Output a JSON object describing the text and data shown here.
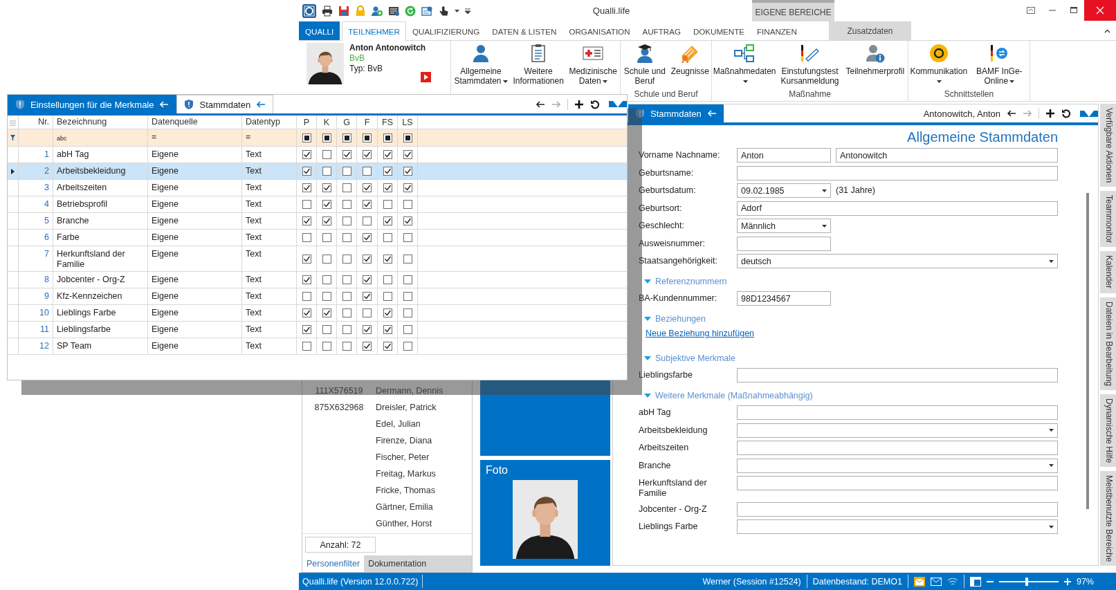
{
  "window": {
    "title": "Qualli.life",
    "context_group": "EIGENE BEREICHE"
  },
  "ribbon": {
    "tabs": [
      {
        "label": "QUALLI",
        "kind": "app",
        "selected": false
      },
      {
        "label": "TEILNEHMER",
        "kind": "tab",
        "selected": true
      },
      {
        "label": "QUALIFIZIERUNG",
        "kind": "tab",
        "selected": false
      },
      {
        "label": "DATEN & LISTEN",
        "kind": "tab",
        "selected": false
      },
      {
        "label": "ORGANISATION",
        "kind": "tab",
        "selected": false
      },
      {
        "label": "AUFTRAG",
        "kind": "tab",
        "selected": false
      },
      {
        "label": "DOKUMENTE",
        "kind": "tab",
        "selected": false
      },
      {
        "label": "FINANZEN",
        "kind": "tab",
        "selected": false
      },
      {
        "label": "Zusatzdaten",
        "kind": "context",
        "selected": false
      }
    ],
    "participant": {
      "name": "Anton Antonowitch",
      "program": "BvB",
      "type": "Typ: BvB"
    },
    "groups": [
      {
        "buttons": [
          {
            "label": "Allgemeine Stammdaten",
            "dropdown": true
          },
          {
            "label": "Weitere Informationen",
            "dropdown": false
          },
          {
            "label": "Medizinische Daten",
            "dropdown": true
          }
        ]
      },
      {
        "label": "Schule und Beruf",
        "buttons": [
          {
            "label": "Schule und Beruf",
            "dropdown": false
          },
          {
            "label": "Zeugnisse",
            "dropdown": false
          }
        ]
      },
      {
        "label": "Maßnahme",
        "buttons": [
          {
            "label": "Maßnahmedaten",
            "dropdown": true
          },
          {
            "label": "Einstufungstest Kursanmeldung",
            "dropdown": false
          },
          {
            "label": "Teilnehmerprofil",
            "dropdown": false
          }
        ]
      },
      {
        "label": "Schnittstellen",
        "buttons": [
          {
            "label": "Kommunikation",
            "dropdown": true
          },
          {
            "label": "BAMF InGe-Online",
            "dropdown": true
          }
        ]
      }
    ]
  },
  "settings_dialog": {
    "tabs": [
      {
        "label": "Einstellungen für die Merkmale",
        "selected": true
      },
      {
        "label": "Stammdaten",
        "selected": false
      }
    ],
    "columns": [
      "Nr.",
      "Bezeichnung",
      "Datenquelle",
      "Datentyp",
      "P",
      "K",
      "G",
      "F",
      "FS",
      "LS"
    ],
    "filter": {
      "name": "abc",
      "source": "=",
      "type": "=",
      "checks": [
        {
          "indeterminate": true
        },
        {
          "indeterminate": true
        },
        {
          "indeterminate": true
        },
        {
          "indeterminate": true
        },
        {
          "indeterminate": true
        },
        {
          "indeterminate": true
        }
      ]
    },
    "rows": [
      {
        "nr": "1",
        "name": "abH Tag",
        "source": "Eigene",
        "type": "Text",
        "selected": false,
        "checks": [
          true,
          false,
          true,
          true,
          true,
          true
        ]
      },
      {
        "nr": "2",
        "name": "Arbeitsbekleidung",
        "source": "Eigene",
        "type": "Text",
        "selected": true,
        "checks": [
          true,
          false,
          false,
          false,
          true,
          true
        ]
      },
      {
        "nr": "3",
        "name": "Arbeitszeiten",
        "source": "Eigene",
        "type": "Text",
        "selected": false,
        "checks": [
          true,
          true,
          false,
          true,
          true,
          true
        ]
      },
      {
        "nr": "4",
        "name": "Betriebsprofil",
        "source": "Eigene",
        "type": "Text",
        "selected": false,
        "checks": [
          false,
          true,
          false,
          true,
          false,
          false
        ]
      },
      {
        "nr": "5",
        "name": "Branche",
        "source": "Eigene",
        "type": "Text",
        "selected": false,
        "checks": [
          true,
          true,
          false,
          false,
          true,
          true
        ]
      },
      {
        "nr": "6",
        "name": "Farbe",
        "source": "Eigene",
        "type": "Text",
        "selected": false,
        "checks": [
          false,
          false,
          false,
          true,
          false,
          false
        ]
      },
      {
        "nr": "7",
        "name": "Herkunftsland der Familie",
        "source": "Eigene",
        "type": "Text",
        "selected": false,
        "checks": [
          true,
          false,
          false,
          true,
          true,
          false
        ]
      },
      {
        "nr": "8",
        "name": "Jobcenter - Org-Z",
        "source": "Eigene",
        "type": "Text",
        "selected": false,
        "checks": [
          true,
          false,
          false,
          true,
          false,
          false
        ]
      },
      {
        "nr": "9",
        "name": "Kfz-Kennzeichen",
        "source": "Eigene",
        "type": "Text",
        "selected": false,
        "checks": [
          false,
          false,
          false,
          true,
          false,
          false
        ]
      },
      {
        "nr": "10",
        "name": "Lieblings Farbe",
        "source": "Eigene",
        "type": "Text",
        "selected": false,
        "checks": [
          true,
          true,
          false,
          false,
          true,
          false
        ]
      },
      {
        "nr": "11",
        "name": "Lieblingsfarbe",
        "source": "Eigene",
        "type": "Text",
        "selected": false,
        "checks": [
          true,
          false,
          false,
          true,
          true,
          false
        ]
      },
      {
        "nr": "12",
        "name": "SP Team",
        "source": "Eigene",
        "type": "Text",
        "selected": false,
        "checks": [
          false,
          false,
          false,
          true,
          true,
          false
        ]
      }
    ]
  },
  "person_list": {
    "rows": [
      {
        "id": "111X576519",
        "name": "Dermann, Dennis"
      },
      {
        "id": "875X632968",
        "name": "Dreisler, Patrick"
      },
      {
        "name": "Edel, Julian"
      },
      {
        "name": "Firenze, Diana"
      },
      {
        "name": "Fischer, Peter"
      },
      {
        "name": "Freitag, Markus"
      },
      {
        "name": "Fricke, Thomas"
      },
      {
        "name": "Gärtner, Emilia"
      },
      {
        "name": "Günther, Horst"
      }
    ],
    "count": "Anzahl: 72",
    "tabs": [
      {
        "label": "Personenfilter",
        "selected": true
      },
      {
        "label": "Dokumentation",
        "selected": false
      }
    ]
  },
  "photo_tile": {
    "label": "Foto"
  },
  "form": {
    "tab": "Stammdaten",
    "record": "Antonowitch, Anton",
    "title": "Allgemeine Stammdaten",
    "items": [
      {
        "kind": "field",
        "label": "Vorname Nachname:",
        "inputs": [
          {
            "kind": "text",
            "value": "Anton"
          },
          {
            "kind": "text",
            "value": "Antonowitch"
          }
        ]
      },
      {
        "kind": "field",
        "label": "Geburtsname:",
        "inputs": [
          {
            "kind": "text"
          }
        ]
      },
      {
        "kind": "field",
        "label": "Geburtsdatum:",
        "inputs": [
          {
            "kind": "dropdown",
            "value": "09.02.1985"
          }
        ],
        "note": "(31 Jahre)"
      },
      {
        "kind": "field",
        "label": "Geburtsort:",
        "inputs": [
          {
            "kind": "text",
            "value": "Adorf"
          }
        ]
      },
      {
        "kind": "field",
        "label": "Geschlecht:",
        "inputs": [
          {
            "kind": "dropdown",
            "value": "Männlich"
          }
        ]
      },
      {
        "kind": "field",
        "label": "Ausweisnummer:",
        "inputs": [
          {
            "kind": "text"
          }
        ]
      },
      {
        "kind": "field",
        "label": "Staatsangehörigkeit:",
        "inputs": [
          {
            "kind": "dropdown",
            "value": "deutsch"
          }
        ]
      },
      {
        "kind": "section",
        "label": "Referenznummern",
        "expanded": true
      },
      {
        "kind": "field",
        "label": "BA-Kundennummer:",
        "inputs": [
          {
            "kind": "text",
            "value": "98D1234567"
          }
        ]
      },
      {
        "kind": "section",
        "label": "Beziehungen",
        "expanded": true
      },
      {
        "kind": "link",
        "label": "Neue Beziehung hinzufügen"
      },
      {
        "kind": "section",
        "label": "Subjektive Merkmale",
        "expanded": true
      },
      {
        "kind": "field",
        "label": "Lieblingsfarbe",
        "inputs": [
          {
            "kind": "text"
          }
        ]
      },
      {
        "kind": "section",
        "label": "Weitere Merkmale (Maßnahmeabhängig)",
        "expanded": true
      },
      {
        "kind": "field",
        "label": "abH Tag",
        "inputs": [
          {
            "kind": "text"
          }
        ]
      },
      {
        "kind": "field",
        "label": "Arbeitsbekleidung",
        "inputs": [
          {
            "kind": "dropdown"
          }
        ]
      },
      {
        "kind": "field",
        "label": "Arbeitszeiten",
        "inputs": [
          {
            "kind": "text"
          }
        ]
      },
      {
        "kind": "field",
        "label": "Branche",
        "inputs": [
          {
            "kind": "dropdown"
          }
        ]
      },
      {
        "kind": "field",
        "label": "Herkunftsland der Familie",
        "inputs": [
          {
            "kind": "text"
          }
        ]
      },
      {
        "kind": "field",
        "label": "Jobcenter - Org-Z",
        "inputs": [
          {
            "kind": "text"
          }
        ]
      },
      {
        "kind": "field",
        "label": "Lieblings Farbe",
        "inputs": [
          {
            "kind": "dropdown"
          }
        ]
      }
    ]
  },
  "side_tabs": [
    "Verfügbare Aktionen",
    "Teammonitor",
    "Kalender",
    "Dateien in Bearbeitung",
    "Dynamische Hilfe",
    "Meistbenutzte Bereiche"
  ],
  "status_bar": {
    "version": "Qualli.life (Version 12.0.0.722)",
    "session": "Werner (Session #12524)",
    "database": "Datenbestand: DEMO1",
    "zoom": {
      "level": 0.47,
      "reading": "97%"
    }
  }
}
